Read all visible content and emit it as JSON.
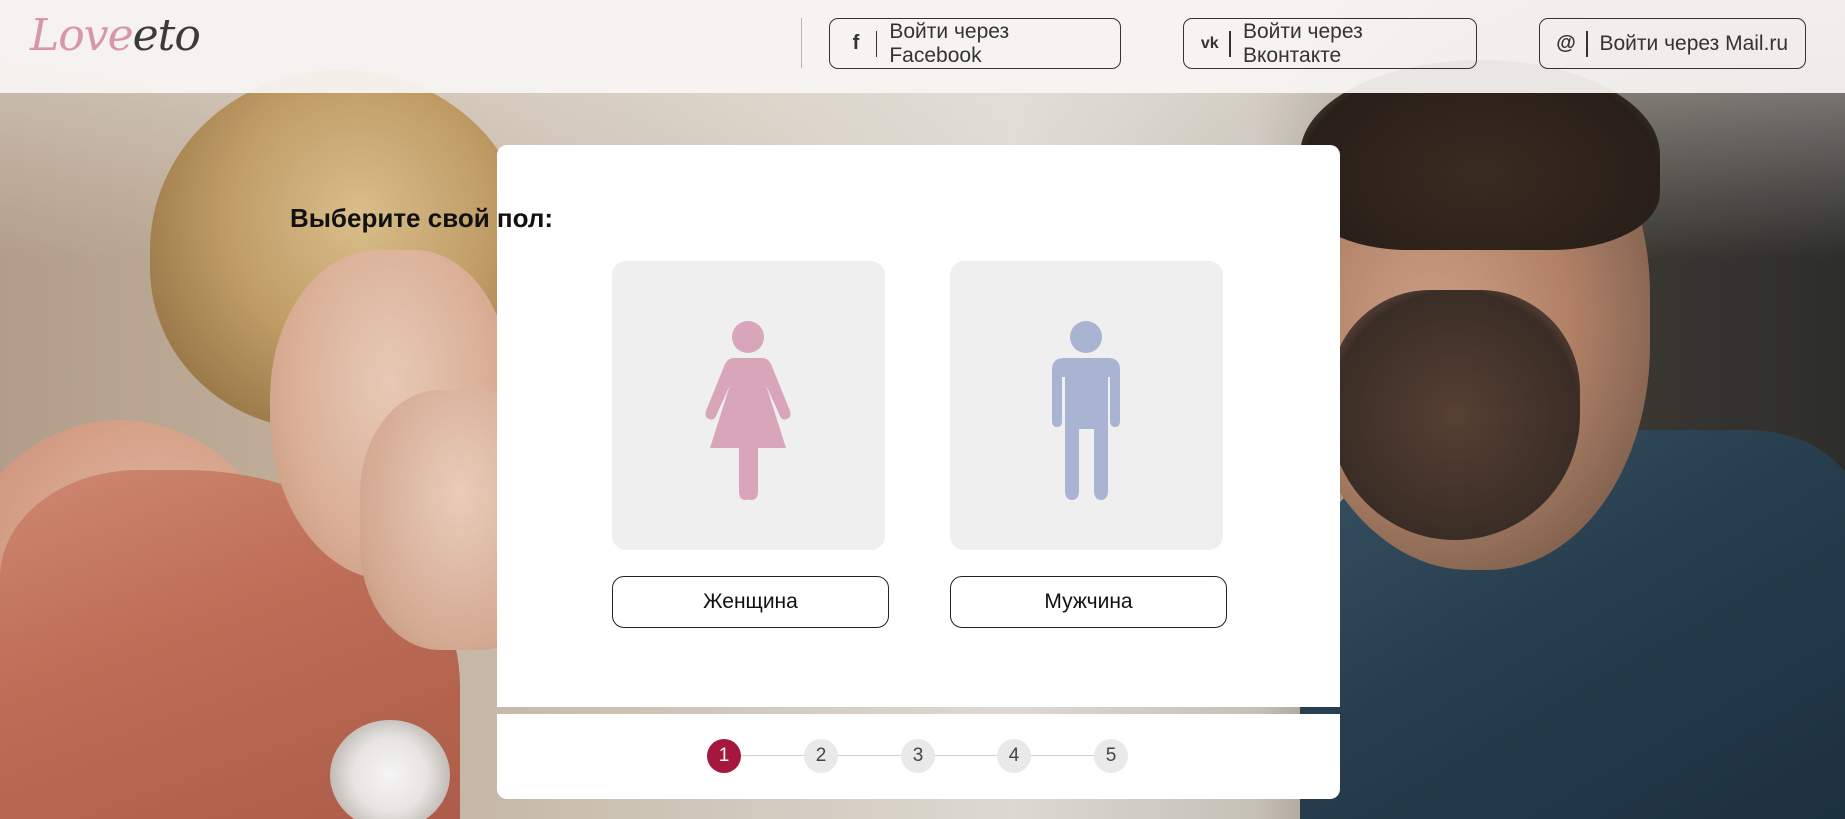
{
  "header": {
    "logo": {
      "part1": "Love",
      "part2": "eto"
    },
    "social": [
      {
        "icon": "facebook-icon",
        "glyph": "f",
        "label": "Войти через Facebook"
      },
      {
        "icon": "vk-icon",
        "glyph": "vk",
        "label": "Войти через Вконтакте"
      },
      {
        "icon": "mail-ru-icon",
        "glyph": "@",
        "label": "Войти через Mail.ru"
      }
    ]
  },
  "form": {
    "title": "Выберите свой пол:",
    "options": [
      {
        "label": "Женщина",
        "icon": "female-figure-icon",
        "color": "#d9a5b8"
      },
      {
        "label": "Мужчина",
        "icon": "male-figure-icon",
        "color": "#a9b4d2"
      }
    ]
  },
  "steps": {
    "items": [
      "1",
      "2",
      "3",
      "4",
      "5"
    ],
    "active": "1",
    "active_color": "#a5173c"
  }
}
